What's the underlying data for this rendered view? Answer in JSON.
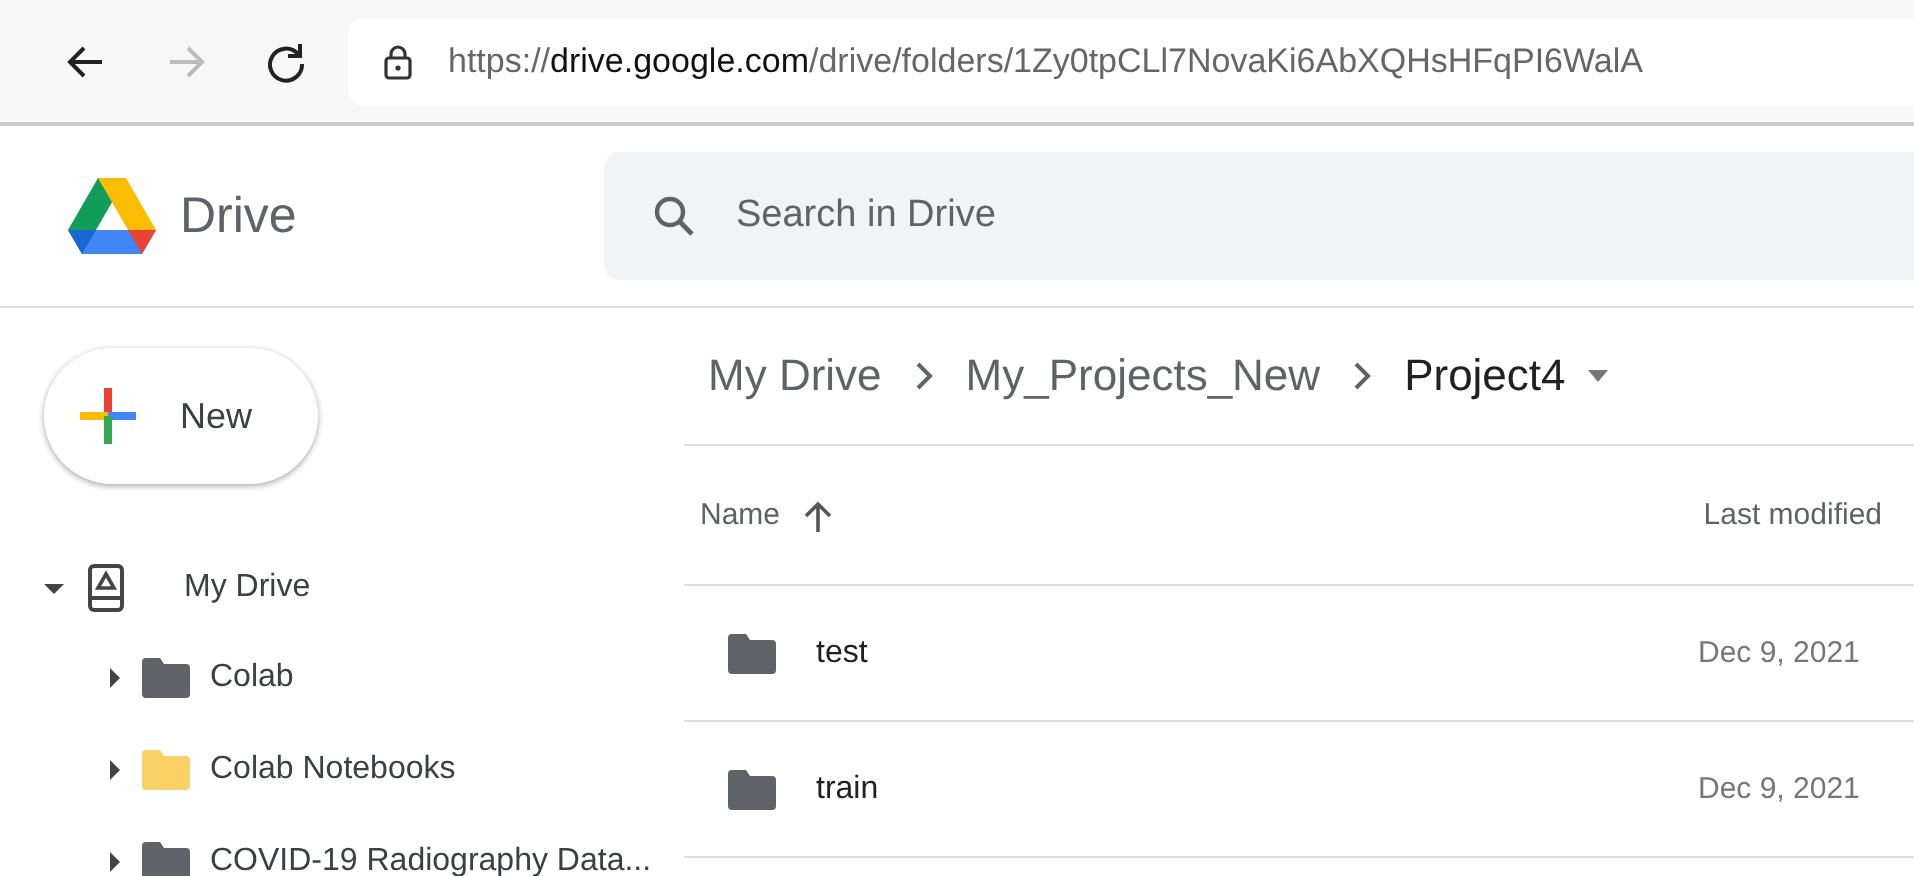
{
  "browser": {
    "nav": [
      {
        "kind": "back",
        "disabled": false
      },
      {
        "kind": "forward",
        "disabled": true
      },
      {
        "kind": "reload",
        "disabled": false
      }
    ],
    "url": {
      "scheme": "https://",
      "host": "drive.google.com",
      "path": "/drive/folders/1Zy0tpCLl7NovaKi6AbXQHsHFqPI6WalA"
    }
  },
  "app": {
    "name": "Drive",
    "search": {
      "placeholder": "Search in Drive"
    }
  },
  "new_button": {
    "label": "New"
  },
  "sidebar": {
    "items": [
      {
        "label": "My Drive",
        "expanded": true,
        "children": [
          {
            "label": "Colab",
            "expanded": false,
            "color": "#5f6368"
          },
          {
            "label": "Colab Notebooks",
            "expanded": false,
            "color": "#fad165"
          },
          {
            "label": "COVID-19 Radiography Data...",
            "expanded": false,
            "color": "#5f6368"
          }
        ]
      }
    ]
  },
  "breadcrumb": [
    {
      "label": "My Drive",
      "current": false
    },
    {
      "label": "My_Projects_New",
      "current": false
    },
    {
      "label": "Project4",
      "current": true
    }
  ],
  "table": {
    "columns": [
      {
        "label": "Name",
        "sorted": true
      },
      {
        "label": "Last modified",
        "sorted": false
      }
    ],
    "rows": [
      {
        "name": "test",
        "modified": "Dec 9, 2021"
      },
      {
        "name": "train",
        "modified": "Dec 9, 2021"
      }
    ]
  }
}
